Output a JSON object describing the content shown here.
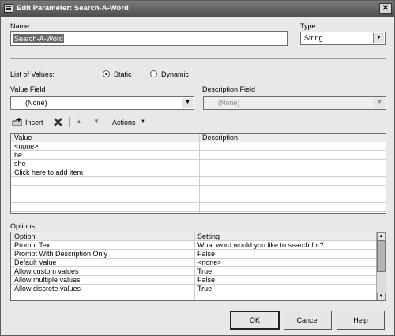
{
  "window": {
    "title": "Edit Parameter: Search-A-Word"
  },
  "name": {
    "label": "Name:",
    "value": "Search-A-Word"
  },
  "type": {
    "label": "Type:",
    "value": "String"
  },
  "list_of_values": {
    "label": "List of Values:",
    "static_label": "Static",
    "dynamic_label": "Dynamic",
    "selected": "Static"
  },
  "value_field": {
    "label": "Value Field",
    "value": "(None)"
  },
  "description_field": {
    "label": "Description Field",
    "value": "(None)"
  },
  "toolbar": {
    "insert_label": "Insert",
    "actions_label": "Actions"
  },
  "values_table": {
    "headers": [
      "Value",
      "Description"
    ],
    "rows": [
      {
        "value": "<none>",
        "description": ""
      },
      {
        "value": "he",
        "description": ""
      },
      {
        "value": "she",
        "description": ""
      },
      {
        "value": "Click here to add item",
        "description": ""
      }
    ]
  },
  "options": {
    "label": "Options:",
    "headers": [
      "Option",
      "Setting"
    ],
    "rows": [
      {
        "option": "Prompt Text",
        "setting": "What word would you like to search for?"
      },
      {
        "option": "Prompt With Description Only",
        "setting": "False"
      },
      {
        "option": "Default Value",
        "setting": "<none>"
      },
      {
        "option": "Allow custom values",
        "setting": "True"
      },
      {
        "option": "Allow multiple values",
        "setting": "False"
      },
      {
        "option": "Allow discrete values",
        "setting": "True"
      }
    ]
  },
  "buttons": {
    "ok": "OK",
    "cancel": "Cancel",
    "help": "Help"
  },
  "colors": {
    "titlebar": "#5e5e5e",
    "dialog_bg": "#e8e8e8",
    "name_selection": "#6a6a6a"
  }
}
